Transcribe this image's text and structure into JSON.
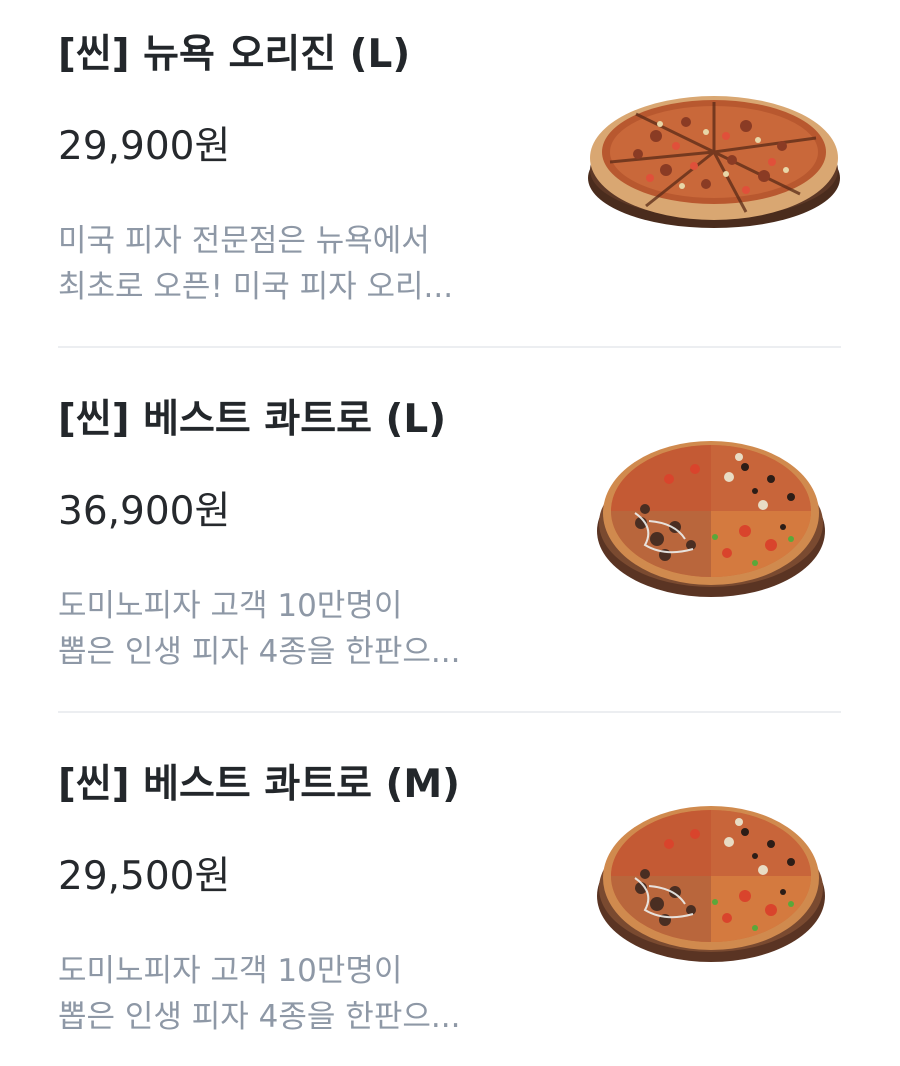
{
  "menu": {
    "items": [
      {
        "name": "[씬] 뉴욕 오리진 (L)",
        "price": "29,900원",
        "desc_line1": "미국 피자 전문점은 뉴욕에서",
        "desc_line2": "최초로 오픈! 미국 피자 오리...",
        "image_icon": "pizza-ny-origin-image"
      },
      {
        "name": "[씬] 베스트 콰트로 (L)",
        "price": "36,900원",
        "desc_line1": "도미노피자 고객 10만명이",
        "desc_line2": "뽑은 인생 피자 4종을 한판으...",
        "image_icon": "pizza-best-quattro-image"
      },
      {
        "name": "[씬] 베스트 콰트로 (M)",
        "price": "29,500원",
        "desc_line1": "도미노피자 고객 10만명이",
        "desc_line2": "뽑은 인생 피자 4종을 한판으...",
        "image_icon": "pizza-best-quattro-image"
      }
    ]
  },
  "colors": {
    "title": "#23272b",
    "price": "#26292d",
    "description": "#8e98a6",
    "divider": "#eceef1",
    "background": "#ffffff"
  }
}
